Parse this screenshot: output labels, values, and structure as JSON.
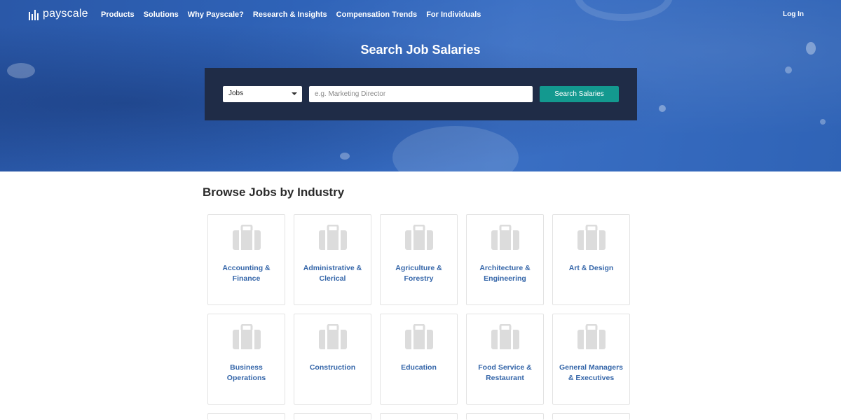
{
  "brand": {
    "name": "payscale"
  },
  "nav": {
    "items": [
      "Products",
      "Solutions",
      "Why Payscale?",
      "Research & Insights",
      "Compensation Trends",
      "For Individuals"
    ],
    "login": "Log In"
  },
  "hero": {
    "title": "Search Job Salaries",
    "select_value": "Jobs",
    "query_placeholder": "e.g. Marketing Director",
    "search_button": "Search Salaries"
  },
  "browse": {
    "title": "Browse Jobs by Industry",
    "industries": [
      "Accounting & Finance",
      "Administrative & Clerical",
      "Agriculture & Forestry",
      "Architecture & Engineering",
      "Art & Design",
      "Business Operations",
      "Construction",
      "Education",
      "Food Service & Restaurant",
      "General Managers & Executives"
    ],
    "card_icon": "briefcase-icon"
  },
  "colors": {
    "hero_blue": "#2f63b8",
    "search_panel": "#1f2c47",
    "search_button": "#13998f",
    "link_blue": "#3566a9",
    "icon_gray": "#dcdcdc"
  }
}
